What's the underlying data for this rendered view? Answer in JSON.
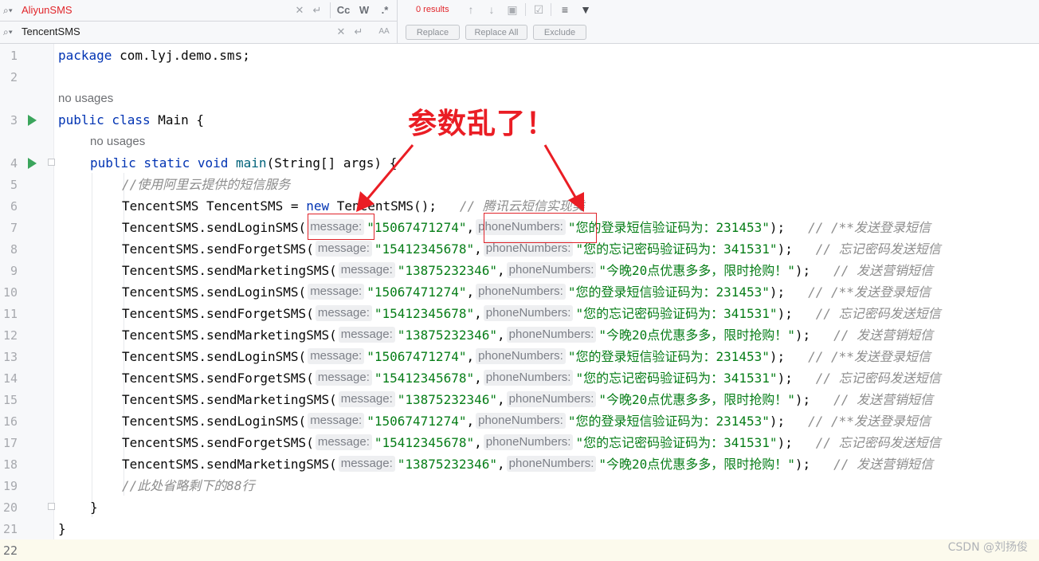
{
  "find": {
    "search_text": "AliyunSMS",
    "replace_text": "TencentSMS",
    "results": "0 results",
    "btn_case": "Cc",
    "btn_words": "W",
    "btn_regex": ".*",
    "btn_preserve": "AA",
    "replace_label": "Replace",
    "replace_all_label": "Replace All",
    "exclude_label": "Exclude"
  },
  "editor": {
    "l1_kw": "package",
    "l1_rest": " com.lyj.demo.sms;",
    "usage": "no usages",
    "l3_kw": "public class",
    "l3_rest": " Main {",
    "l4_kw1": "public static void",
    "l4_fn": "main",
    "l4_rest": "(String[] args) {",
    "l5_comment": "//使用阿里云提供的短信服务",
    "l6_a": "TencentSMS TencentSMS = ",
    "l6_kw": "new",
    "l6_b": " TencentSMS();   ",
    "l6_comment": "// 腾讯云短信实现类",
    "hint_message": "message:",
    "hint_phone": "phoneNumbers:",
    "comma": ",",
    "close": ");",
    "login_call": "TencentSMS.sendLoginSMS(",
    "login_phone": "\"15067471274\"",
    "login_msg": "\"您的登录短信验证码为：231453\"",
    "login_comment": "// /**发送登录短信",
    "forget_call": "TencentSMS.sendForgetSMS(",
    "forget_phone": "\"15412345678\"",
    "forget_msg": "\"您的忘记密码验证码为：341531\"",
    "forget_comment": "// 忘记密码发送短信",
    "market_call": "TencentSMS.sendMarketingSMS(",
    "market_phone": "\"13875232346\"",
    "market_msg": "\"今晚20点优惠多多，限时抢购！\"",
    "market_comment": "// 发送营销短信",
    "l19_comment": "//此处省略剩下的88行",
    "close_brace": "}"
  },
  "line_numbers": [
    "1",
    "2",
    "3",
    "4",
    "5",
    "6",
    "7",
    "8",
    "9",
    "10",
    "11",
    "12",
    "13",
    "14",
    "15",
    "16",
    "17",
    "18",
    "19",
    "20",
    "21",
    "22"
  ],
  "annotation": {
    "title": "参数乱了！"
  },
  "watermark": "CSDN @刘扬俊",
  "colors": {
    "keyword": "#0033b3",
    "string": "#067d17",
    "comment": "#8c8c8c",
    "annotation_red": "#ea1d24"
  }
}
